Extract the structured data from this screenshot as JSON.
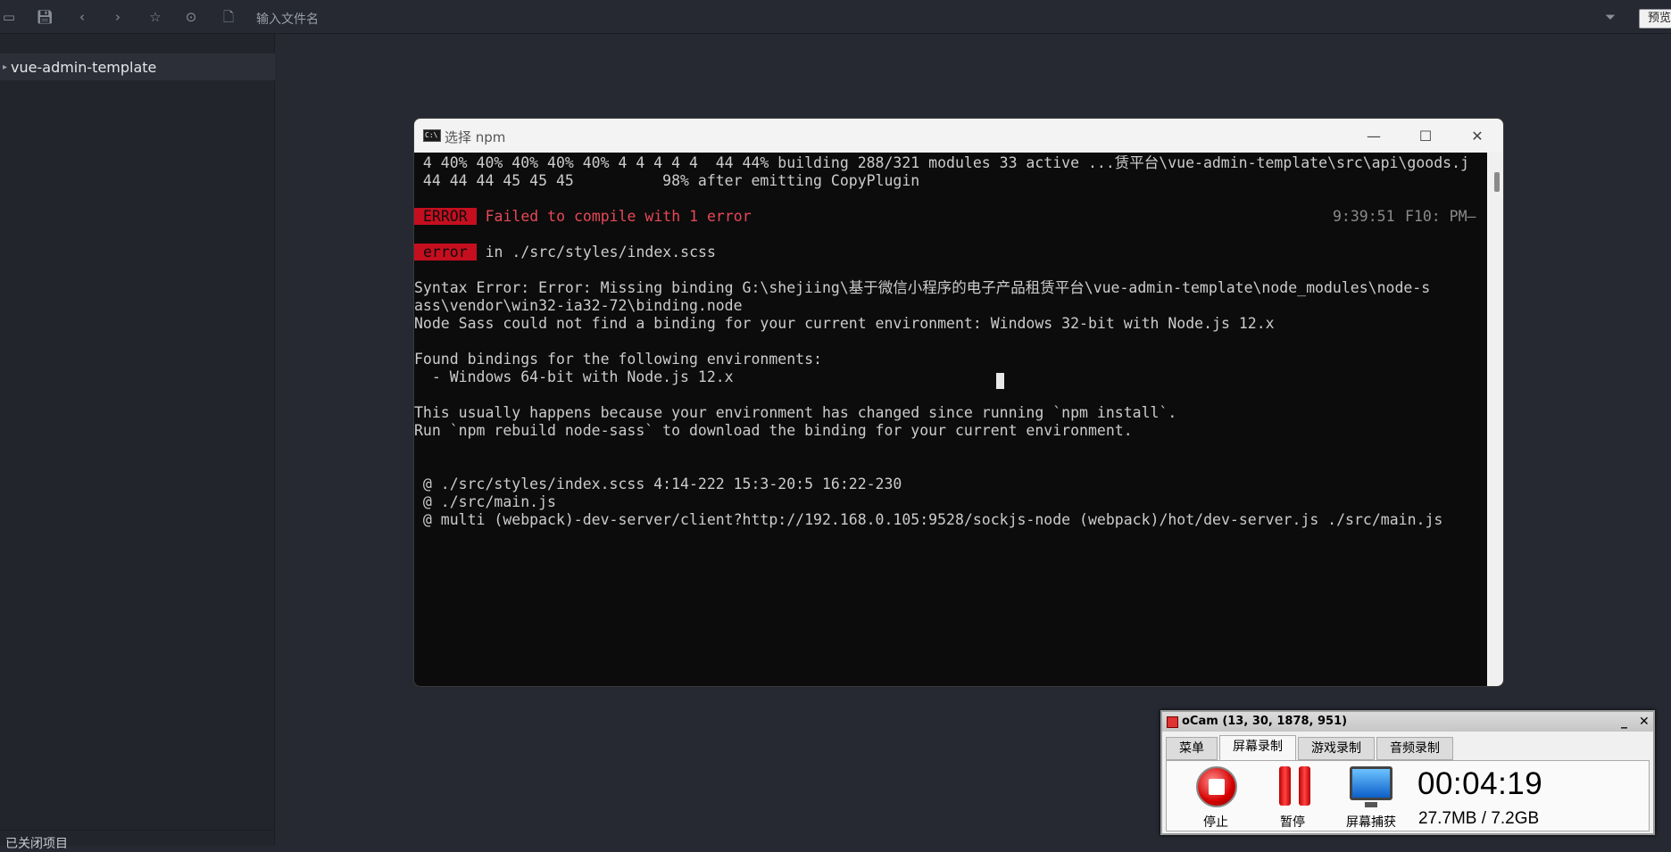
{
  "toolbar": {
    "search_placeholder": "输入文件名",
    "preview_label": "预览"
  },
  "sidebar": {
    "project": "vue-admin-template",
    "closed_projects": "已关闭项目"
  },
  "console": {
    "title": "选择 npm",
    "lines": [
      " 4 40% 40% 40% 40% 40% 4 4 4 4 4  44 44% building 288/321 modules 33 active ...赁平台\\vue-admin-template\\src\\api\\goods.j",
      " 44 44 44 45 45 45          98% after emitting CopyPlugin",
      "Failed to compile with 1 error",
      "9:39:51 ",
      "F10: PM—",
      "in ./src/styles/index.scss",
      "Syntax Error: Error: Missing binding G:\\shejiing\\基于微信小程序的电子产品租赁平台\\vue-admin-template\\node_modules\\node-s",
      "ass\\vendor\\win32-ia32-72\\binding.node",
      "Node Sass could not find a binding for your current environment: Windows 32-bit with Node.js 12.x",
      "Found bindings for the following environments:",
      "  - Windows 64-bit with Node.js 12.x",
      "This usually happens because your environment has changed since running `npm install`.",
      "Run `npm rebuild node-sass` to download the binding for your current environment.",
      " @ ./src/styles/index.scss 4:14-222 15:3-20:5 16:22-230",
      " @ ./src/main.js",
      " @ multi (webpack)-dev-server/client?http://192.168.0.105:9528/sockjs-node (webpack)/hot/dev-server.js ./src/main.js"
    ],
    "error_tag": "ERROR",
    "error_tag_small": "error"
  },
  "ocam": {
    "title": "oCam (13, 30, 1878, 951)",
    "minimize": "_",
    "close": "✕",
    "tabs": [
      "菜单",
      "屏幕录制",
      "游戏录制",
      "音频录制"
    ],
    "stop_label": "停止",
    "pause_label": "暂停",
    "capture_label": "屏幕捕获",
    "time": "00:04:19",
    "size": "27.7MB / 7.2GB"
  },
  "colors": {
    "error_red": "#c50f1f",
    "error_text": "#e74856"
  }
}
